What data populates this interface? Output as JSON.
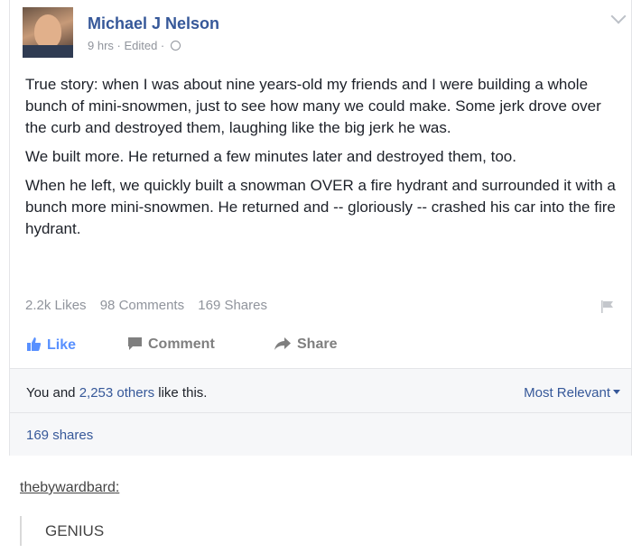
{
  "post": {
    "author": "Michael J Nelson",
    "meta": "9 hrs · Edited ·",
    "paragraphs": [
      "True story: when I was about nine years-old my friends and I were building a whole bunch of mini-snowmen, just to see how many we could make. Some jerk drove over the curb and destroyed them, laughing like the big jerk he was.",
      "We built more. He returned a few minutes later and destroyed them, too.",
      "When he left, we quickly built a snowman OVER a fire hydrant and surrounded it with a bunch more mini-snowmen. He returned and -- gloriously -- crashed his car into the fire hydrant."
    ],
    "counts": {
      "likes": "2.2k Likes",
      "comments": "98 Comments",
      "shares": "169 Shares"
    }
  },
  "actions": {
    "like": "Like",
    "comment": "Comment",
    "share": "Share"
  },
  "reactions": {
    "prefix": "You and ",
    "others_link": "2,253 others",
    "suffix": " like this.",
    "sort_label": "Most Relevant"
  },
  "shares_link": "169 shares",
  "tumblr": {
    "username": "thebywardbard",
    "username_suffix": ":",
    "reply": "GENIUS"
  },
  "colors": {
    "link_blue": "#365899",
    "like_blue": "#5890ff",
    "muted_gray": "#90949c",
    "panel_bg": "#f6f7f9"
  },
  "icons": [
    "globe-icon",
    "flag-icon",
    "thumbs-up-icon",
    "comment-icon",
    "share-arrow-icon",
    "chevron-down-icon"
  ]
}
